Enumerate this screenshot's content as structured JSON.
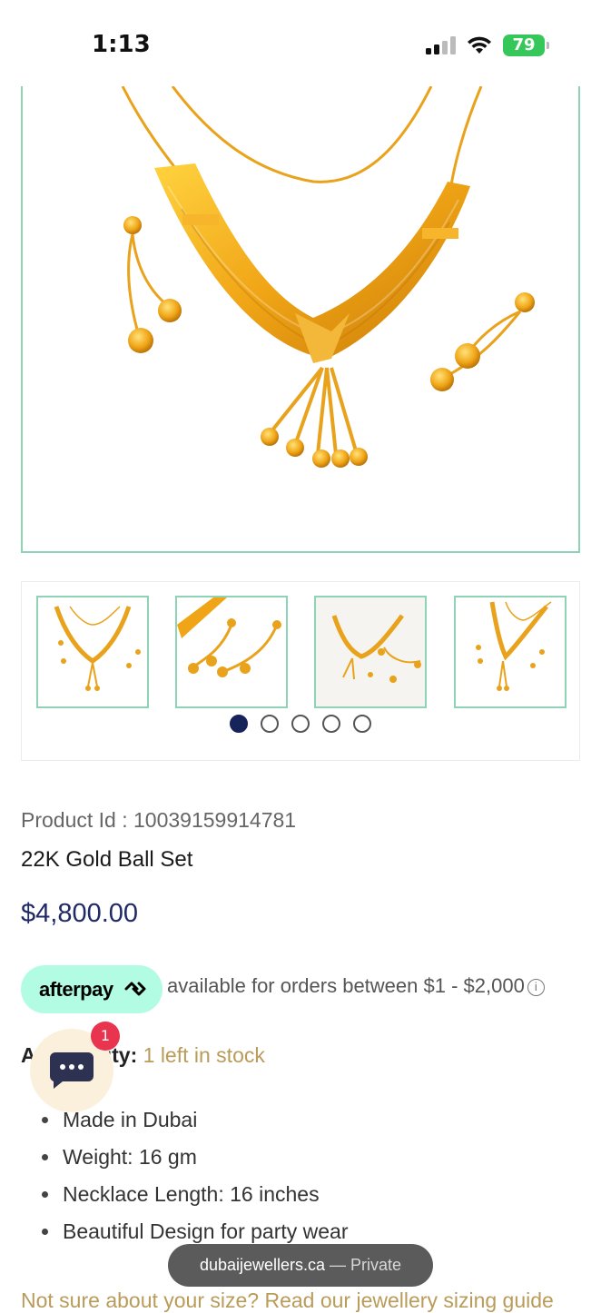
{
  "status_bar": {
    "time": "1:13",
    "battery": "79"
  },
  "gallery": {
    "main_alt": "22K Gold Ball Set necklace and earrings",
    "thumbnails": [
      "thumb-1",
      "thumb-2",
      "thumb-3",
      "thumb-4"
    ],
    "dots_total": 5,
    "dots_active": 1
  },
  "product": {
    "id_label": "Product Id : 10039159914781",
    "name": "22K Gold Ball Set",
    "price": "$4,800.00"
  },
  "afterpay": {
    "logo_text": "afterpay",
    "message": "available for orders between $1 - $2,000",
    "info_icon": "info-icon"
  },
  "availability": {
    "label": "Availability:",
    "value": "1 left in stock"
  },
  "chat": {
    "badge_count": "1",
    "icon": "chat-icon"
  },
  "specs": [
    "Made in Dubai",
    "Weight: 16 gm",
    "Necklace Length: 16 inches",
    "Beautiful Design for party wear"
  ],
  "sizing_link": "Not sure about your size? Read our jewellery sizing guide",
  "url_bar": {
    "domain": "dubaijewellers.ca",
    "mode": " — Private"
  },
  "colors": {
    "accent_green": "#8fd3b7",
    "price_navy": "#1f2a66",
    "gold_text": "#b99b5a",
    "afterpay_mint": "#b2fce4",
    "badge_red": "#e8344e"
  }
}
